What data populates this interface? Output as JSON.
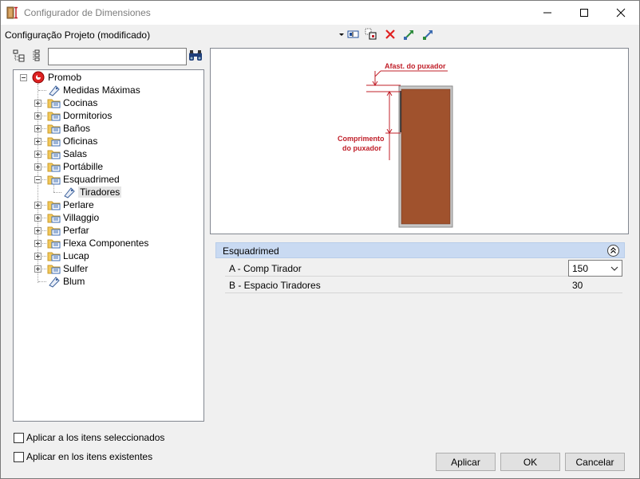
{
  "window": {
    "title": "Configurador de Dimensiones",
    "config_label": "Configuração Projeto (modificado)"
  },
  "toolbar": {
    "icons": [
      "dropdown-arrow-icon",
      "edit-field-icon",
      "copy-layout-icon",
      "delete-x-icon",
      "import-icon",
      "export-icon"
    ]
  },
  "search": {
    "value": "",
    "placeholder": ""
  },
  "tree": {
    "root": "Promob",
    "items": [
      {
        "label": "Medidas Máximas",
        "type": "leaf"
      },
      {
        "label": "Cocinas",
        "type": "folder"
      },
      {
        "label": "Dormitorios",
        "type": "folder"
      },
      {
        "label": "Baños",
        "type": "folder"
      },
      {
        "label": "Oficinas",
        "type": "folder"
      },
      {
        "label": "Salas",
        "type": "folder"
      },
      {
        "label": "Portábille",
        "type": "folder"
      },
      {
        "label": "Esquadrimed",
        "type": "folder-open"
      },
      {
        "label": "Tiradores",
        "type": "leaf-child"
      },
      {
        "label": "Perlare",
        "type": "folder"
      },
      {
        "label": "Villaggio",
        "type": "folder"
      },
      {
        "label": "Perfar",
        "type": "folder"
      },
      {
        "label": "Flexa Componentes",
        "type": "folder"
      },
      {
        "label": "Lucap",
        "type": "folder"
      },
      {
        "label": "Sulfer",
        "type": "folder"
      },
      {
        "label": "Blum",
        "type": "leaf"
      }
    ]
  },
  "preview": {
    "label_top": "Afast. do puxador",
    "label_side_1": "Comprimento",
    "label_side_2": "do puxador",
    "door_color": "#a0522d",
    "annotation_color": "#c0202a"
  },
  "properties": {
    "group_title": "Esquadrimed",
    "rows": [
      {
        "name": "A -  Comp Tirador",
        "value": "150"
      },
      {
        "name": "B -  Espacio Tiradores",
        "value": "30"
      }
    ]
  },
  "options": {
    "apply_selected": "Aplicar a los itens seleccionados",
    "apply_existing": "Aplicar en los itens existentes"
  },
  "buttons": {
    "apply": "Aplicar",
    "ok": "OK",
    "cancel": "Cancelar"
  }
}
